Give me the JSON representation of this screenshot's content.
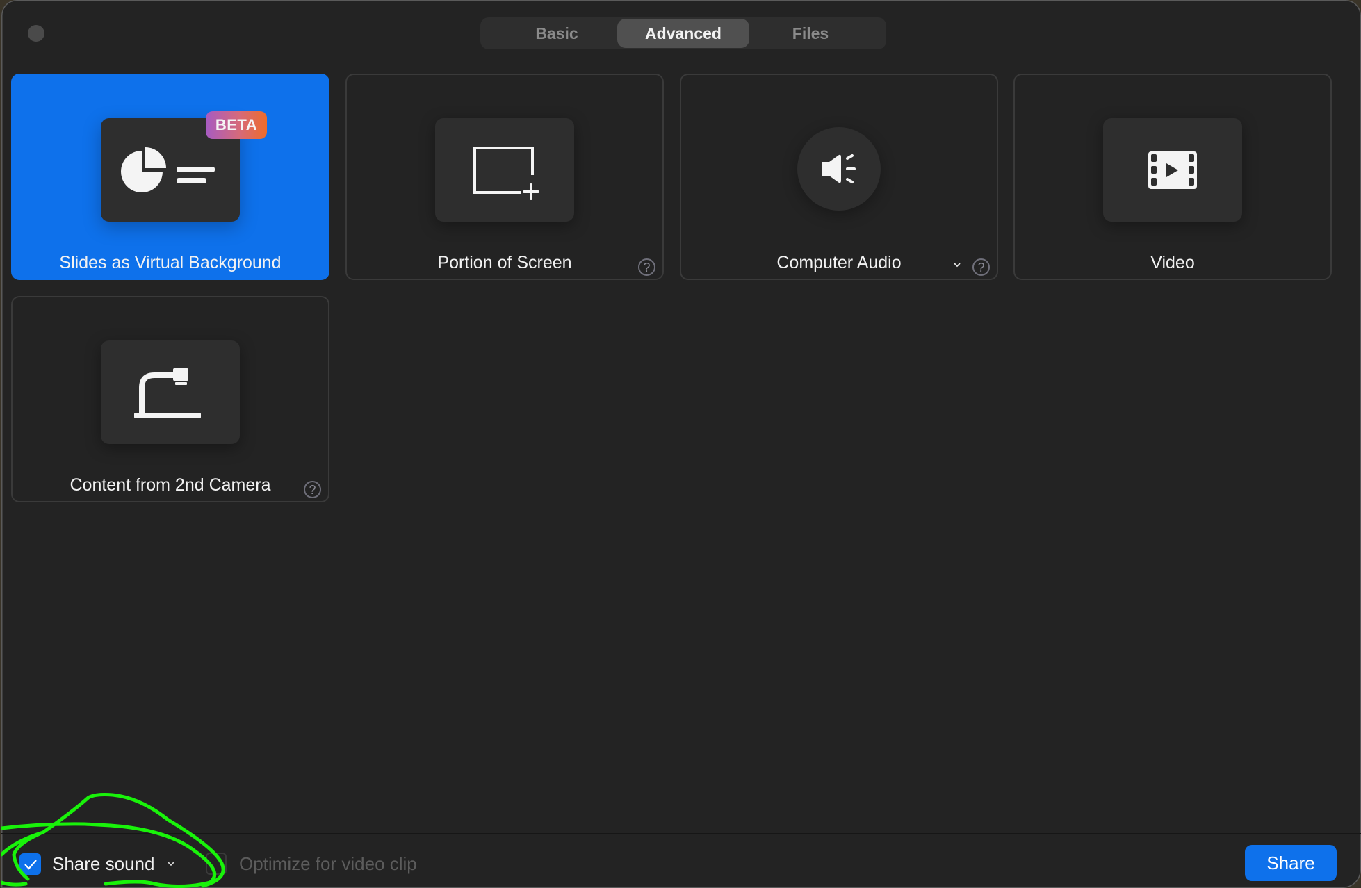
{
  "window": {
    "close_button": "close-dot"
  },
  "tabs": [
    {
      "label": "Basic",
      "active": false
    },
    {
      "label": "Advanced",
      "active": true
    },
    {
      "label": "Files",
      "active": false
    }
  ],
  "cards": [
    {
      "label": "Slides as Virtual Background",
      "icon": "slides-chart-icon",
      "badge": "BETA",
      "selected": true,
      "help": false,
      "dropdown": false
    },
    {
      "label": "Portion of Screen",
      "icon": "screen-portion-icon",
      "selected": false,
      "help": true,
      "dropdown": false
    },
    {
      "label": "Computer Audio",
      "icon": "speaker-icon",
      "selected": false,
      "help": true,
      "dropdown": true
    },
    {
      "label": "Video",
      "icon": "film-play-icon",
      "selected": false,
      "help": false,
      "dropdown": false
    },
    {
      "label": "Content from 2nd Camera",
      "icon": "document-camera-icon",
      "selected": false,
      "help": true,
      "dropdown": false
    }
  ],
  "help_glyph": "?",
  "footer": {
    "share_sound": {
      "label": "Share sound",
      "checked": true
    },
    "optimize_video": {
      "label": "Optimize for video clip",
      "checked": false,
      "disabled": true
    },
    "share_button": "Share"
  },
  "colors": {
    "accent": "#0e71eb",
    "background": "#232323",
    "annotation": "#19f20a",
    "beta_gradient_start": "#a75bc2",
    "beta_gradient_end": "#ee6c2a"
  }
}
